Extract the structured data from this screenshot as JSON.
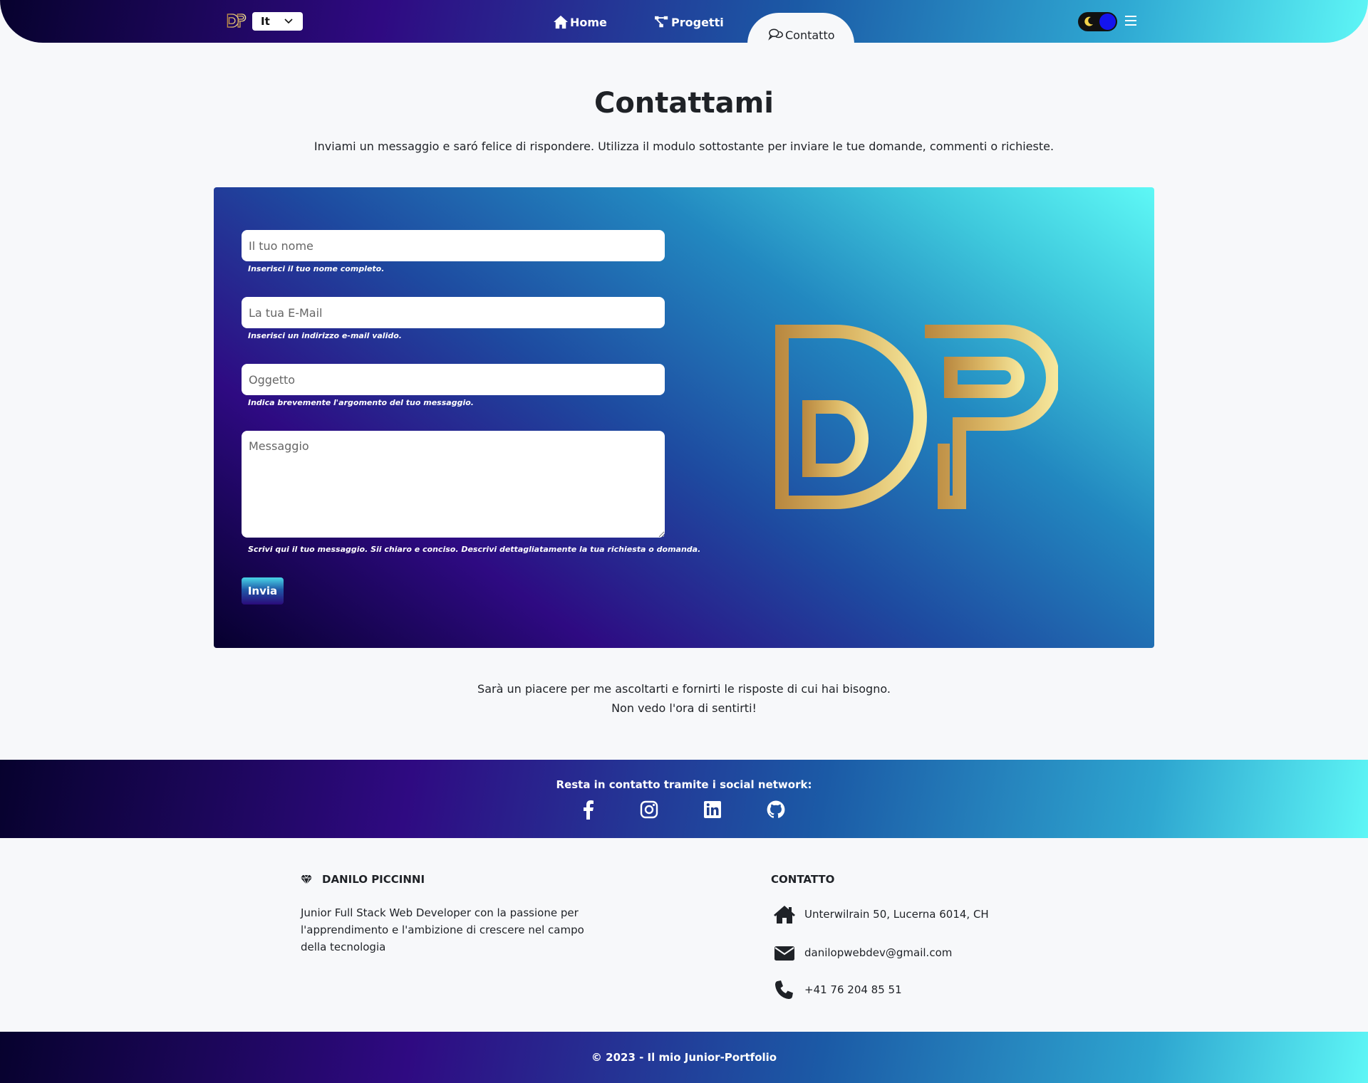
{
  "nav": {
    "language": "It",
    "home": "Home",
    "projects": "Progetti",
    "contact": "Contatto"
  },
  "page": {
    "title": "Contattami",
    "intro": "Inviami un messaggio e saró felice di rispondere. Utilizza il modulo sottostante per inviare le tue domande, commenti o richieste."
  },
  "form": {
    "name_placeholder": "Il tuo nome",
    "name_hint": "Inserisci il tuo nome completo.",
    "email_placeholder": "La tua E-Mail",
    "email_hint": "Inserisci un indirizzo e-mail valido.",
    "subject_placeholder": "Oggetto",
    "subject_hint": "Indica brevemente l'argomento del tuo messaggio.",
    "message_placeholder": "Messaggio",
    "message_hint": "Scrivi qui il tuo messaggio. Sii chiaro e conciso. Descrivi dettagliatamente la tua richiesta o domanda.",
    "send_label": "Invia"
  },
  "closing": {
    "line1": "Sarà un piacere per me ascoltarti e fornirti le risposte di cui hai bisogno.",
    "line2": "Non vedo l'ora di sentirti!"
  },
  "social": {
    "title": "Resta in contatto tramite i social network:",
    "icons": [
      "facebook-icon",
      "instagram-icon",
      "linkedin-icon",
      "github-icon"
    ]
  },
  "footer": {
    "brand": "DANILO PICCINNI",
    "about": "Junior Full Stack Web Developer con la passione per l'apprendimento e l'ambizione di crescere nel campo della tecnologia",
    "contact_title": "CONTATTO",
    "address": "Unterwilrain 50, Lucerna 6014, CH",
    "email": "danilopwebdev@gmail.com",
    "phone": "+41 76 204 85 51",
    "copyright": "© 2023 - Il mio Junior-Portfolio"
  },
  "colors": {
    "gradient_dark": "#07022e",
    "gradient_purple": "#2f0a82",
    "gradient_blue": "#1b5aa6",
    "gradient_cyan": "#5ef6f6",
    "logo_gold": "#d4a85a",
    "toggle_knob": "#1414ee"
  }
}
